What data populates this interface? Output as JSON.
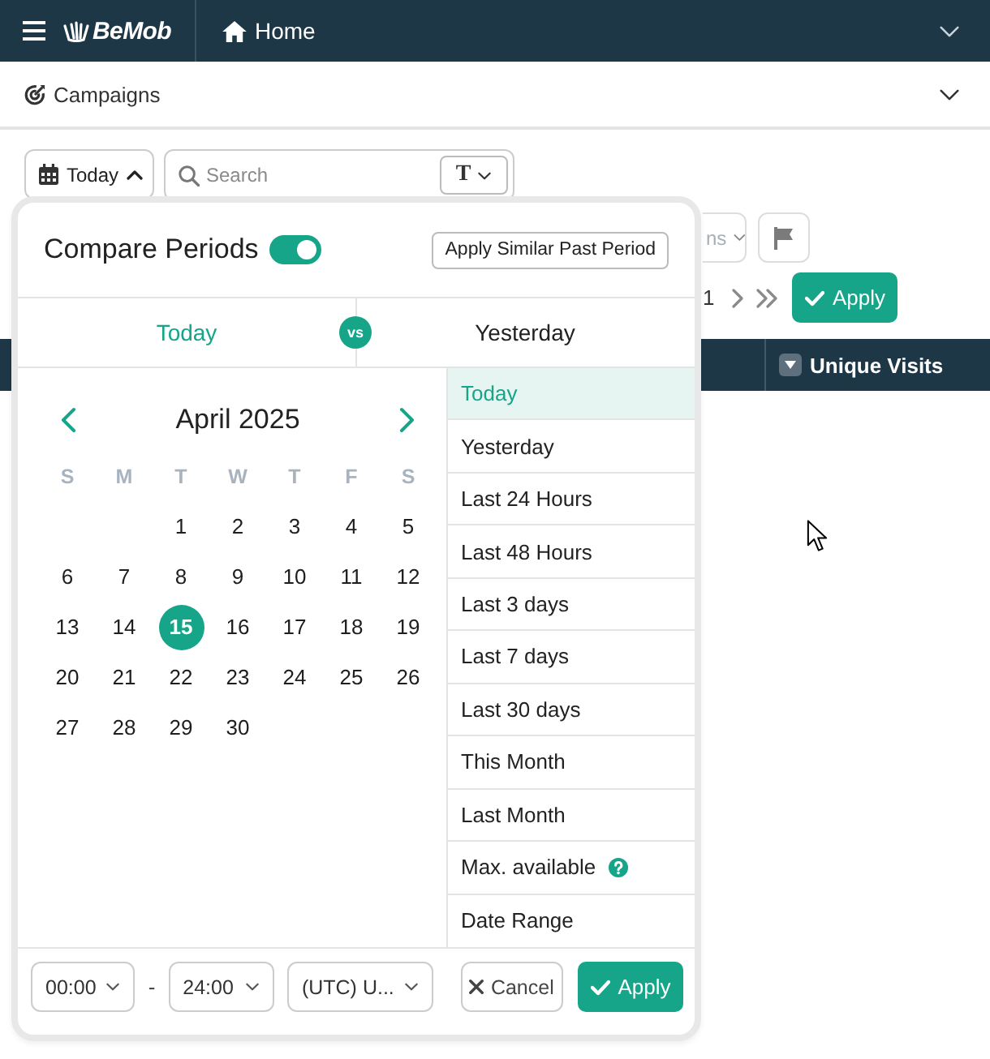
{
  "top_bar": {
    "logo": "BeMob",
    "page": "Home"
  },
  "section_bar": {
    "title": "Campaigns"
  },
  "toolbar": {
    "date_button": {
      "label": "Today",
      "expanded": true
    },
    "search": {
      "placeholder": "Search",
      "mode_button": "T"
    }
  },
  "report": {
    "column_dropdown": {
      "label": "ns"
    },
    "pagination": {
      "page_text": "1"
    },
    "apply_button": "Apply",
    "table": {
      "columns": [
        {
          "label": "Unique Visits"
        }
      ]
    }
  },
  "date_picker": {
    "compare": {
      "title": "Compare Periods",
      "on": true
    },
    "similar_period_button": "Apply Similar Past Period",
    "periods": [
      {
        "label": "Today",
        "selected": true
      },
      {
        "label": "Yesterday",
        "selected": false
      }
    ],
    "vs_badge": "vs",
    "calendar": {
      "month": "April 2025",
      "weekdays": [
        "S",
        "M",
        "T",
        "W",
        "T",
        "F",
        "S"
      ],
      "weeks": [
        [
          {
            "label": "1",
            "selected": false
          },
          {
            "label": "2",
            "selected": false
          },
          {
            "label": "3",
            "selected": false
          },
          {
            "label": "4",
            "selected": false
          },
          {
            "label": "5",
            "selected": false
          }
        ],
        [
          {
            "label": "6",
            "selected": false
          },
          {
            "label": "7",
            "selected": false
          },
          {
            "label": "8",
            "selected": false
          },
          {
            "label": "9",
            "selected": false
          },
          {
            "label": "10",
            "selected": false
          },
          {
            "label": "11",
            "selected": false
          },
          {
            "label": "12",
            "selected": false
          }
        ],
        [
          {
            "label": "13",
            "selected": false
          },
          {
            "label": "14",
            "selected": false
          },
          {
            "label": "15",
            "selected": true
          },
          {
            "label": "16",
            "selected": false
          },
          {
            "label": "17",
            "selected": false
          },
          {
            "label": "18",
            "selected": false
          },
          {
            "label": "19",
            "selected": false
          }
        ],
        [
          {
            "label": "20",
            "selected": false
          },
          {
            "label": "21",
            "selected": false
          },
          {
            "label": "22",
            "selected": false
          },
          {
            "label": "23",
            "selected": false
          },
          {
            "label": "24",
            "selected": false
          },
          {
            "label": "25",
            "selected": false
          },
          {
            "label": "26",
            "selected": false
          }
        ],
        [
          {
            "label": "27",
            "selected": false
          },
          {
            "label": "28",
            "selected": false
          },
          {
            "label": "29",
            "selected": false
          },
          {
            "label": "30",
            "selected": false
          }
        ]
      ]
    },
    "presets": [
      {
        "label": "Today",
        "selected": true
      },
      {
        "label": "Yesterday",
        "selected": false
      },
      {
        "label": "Last 24 Hours",
        "selected": false
      },
      {
        "label": "Last 48 Hours",
        "selected": false
      },
      {
        "label": "Last 3 days",
        "selected": false
      },
      {
        "label": "Last 7 days",
        "selected": false
      },
      {
        "label": "Last 30 days",
        "selected": false
      },
      {
        "label": "This Month",
        "selected": false
      },
      {
        "label": "Last Month",
        "selected": false
      },
      {
        "label": "Max. available",
        "selected": false,
        "help": true
      },
      {
        "label": "Date Range",
        "selected": false
      }
    ],
    "footer": {
      "start_time": "00:00",
      "separator": "-",
      "end_time": "24:00",
      "timezone": "(UTC) U...",
      "cancel_button": "Cancel",
      "apply_button": "Apply"
    }
  }
}
